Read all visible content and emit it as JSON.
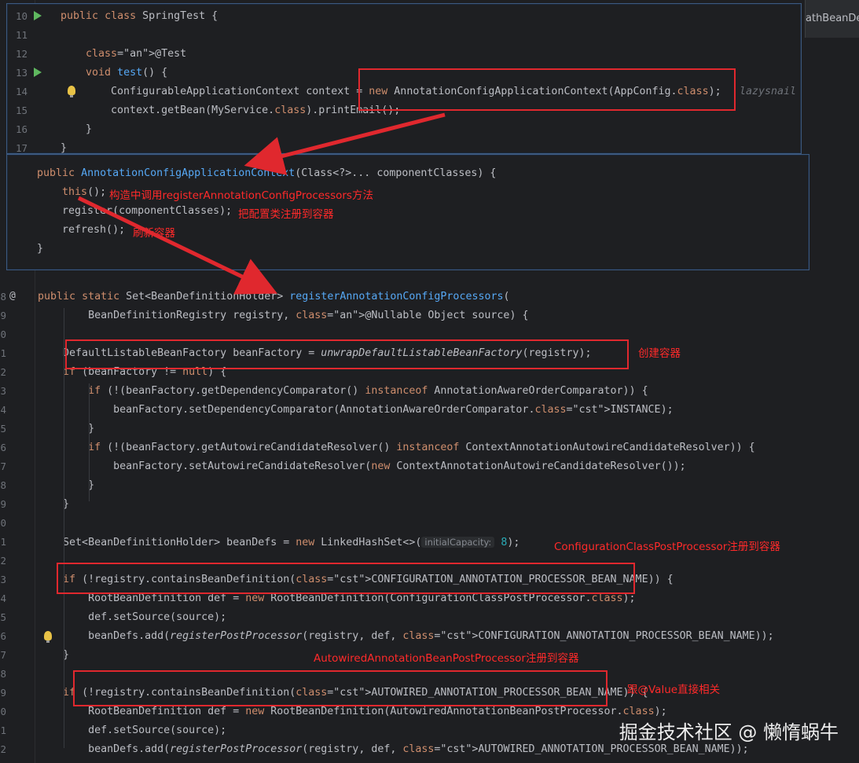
{
  "tab": {
    "label": "athBeanDe"
  },
  "popup1": {
    "lines": [
      {
        "num": "10",
        "code": "public class SpringTest {"
      },
      {
        "num": "11",
        "code": ""
      },
      {
        "num": "12",
        "code": "    @Test"
      },
      {
        "num": "13",
        "code": "    void test() {"
      },
      {
        "num": "14",
        "code": "        ConfigurableApplicationContext context = new AnnotationConfigApplicationContext(AppConfig.class);"
      },
      {
        "num": "15",
        "code": "        context.getBean(MyService.class).printEmail();"
      },
      {
        "num": "16",
        "code": "    }"
      },
      {
        "num": "17",
        "code": "}"
      }
    ],
    "author": "lazysnail"
  },
  "popup2": {
    "lines": [
      "public AnnotationConfigApplicationContext(Class<?>... componentClasses) {",
      "    this();",
      "    register(componentClasses);",
      "    refresh();",
      "}"
    ],
    "notes": [
      "构造中调用registerAnnotationConfigProcessors方法",
      "把配置类注册到容器",
      "刷新容器"
    ]
  },
  "editor": {
    "lines": [
      {
        "num": "8",
        "code": "    public static Set<BeanDefinitionHolder> registerAnnotationConfigProcessors("
      },
      {
        "num": "9",
        "code": "            BeanDefinitionRegistry registry, @Nullable Object source) {"
      },
      {
        "num": "0",
        "code": ""
      },
      {
        "num": "1",
        "code": "        DefaultListableBeanFactory beanFactory = unwrapDefaultListableBeanFactory(registry);"
      },
      {
        "num": "2",
        "code": "        if (beanFactory != null) {"
      },
      {
        "num": "3",
        "code": "            if (!(beanFactory.getDependencyComparator() instanceof AnnotationAwareOrderComparator)) {"
      },
      {
        "num": "4",
        "code": "                beanFactory.setDependencyComparator(AnnotationAwareOrderComparator.INSTANCE);"
      },
      {
        "num": "5",
        "code": "            }"
      },
      {
        "num": "6",
        "code": "            if (!(beanFactory.getAutowireCandidateResolver() instanceof ContextAnnotationAutowireCandidateResolver)) {"
      },
      {
        "num": "7",
        "code": "                beanFactory.setAutowireCandidateResolver(new ContextAnnotationAutowireCandidateResolver());"
      },
      {
        "num": "8",
        "code": "            }"
      },
      {
        "num": "9",
        "code": "        }"
      },
      {
        "num": "0",
        "code": ""
      },
      {
        "num": "1",
        "code": "        Set<BeanDefinitionHolder> beanDefs = new LinkedHashSet<>(8);"
      },
      {
        "num": "2",
        "code": ""
      },
      {
        "num": "3",
        "code": "        if (!registry.containsBeanDefinition(CONFIGURATION_ANNOTATION_PROCESSOR_BEAN_NAME)) {"
      },
      {
        "num": "4",
        "code": "            RootBeanDefinition def = new RootBeanDefinition(ConfigurationClassPostProcessor.class);"
      },
      {
        "num": "5",
        "code": "            def.setSource(source);"
      },
      {
        "num": "6",
        "code": "            beanDefs.add(registerPostProcessor(registry, def, CONFIGURATION_ANNOTATION_PROCESSOR_BEAN_NAME));"
      },
      {
        "num": "7",
        "code": "        }"
      },
      {
        "num": "8",
        "code": ""
      },
      {
        "num": "9",
        "code": "        if (!registry.containsBeanDefinition(AUTOWIRED_ANNOTATION_PROCESSOR_BEAN_NAME)) {"
      },
      {
        "num": "0",
        "code": "            RootBeanDefinition def = new RootBeanDefinition(AutowiredAnnotationBeanPostProcessor.class);"
      },
      {
        "num": "1",
        "code": "            def.setSource(source);"
      },
      {
        "num": "2",
        "code": "            beanDefs.add(registerPostProcessor(registry, def, AUTOWIRED_ANNOTATION_PROCESSOR_BEAN_NAME));"
      }
    ],
    "hint_label": "initialCapacity:",
    "notes": {
      "create": "创建容器",
      "config": "ConfigurationClassPostProcessor注册到容器",
      "autowired": "AutowiredAnnotationBeanPostProcessor注册到容器",
      "value": "跟@Value直接相关"
    }
  },
  "watermark": "掘金技术社区 @ 懒惰蜗牛"
}
